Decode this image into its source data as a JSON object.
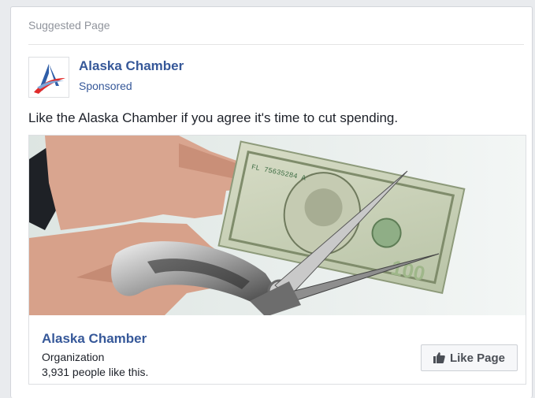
{
  "card": {
    "header": "Suggested Page"
  },
  "page": {
    "name": "Alaska Chamber",
    "sponsored_label": "Sponsored",
    "logo_icon": "alaska-chamber-logo-icon",
    "brand_blue": "#365899",
    "brand_red": "#e02b2b"
  },
  "post": {
    "text": "Like the Alaska Chamber if you agree it's time to cut spending."
  },
  "ad_image": {
    "description_icon": "scissors-cutting-dollar-bill-image",
    "serial_number": "FL 75635284 A",
    "denomination": "100"
  },
  "footer": {
    "name": "Alaska Chamber",
    "category": "Organization",
    "likes_text": "3,931 people like this.",
    "like_button_label": "Like Page",
    "like_icon": "thumbs-up-icon"
  }
}
